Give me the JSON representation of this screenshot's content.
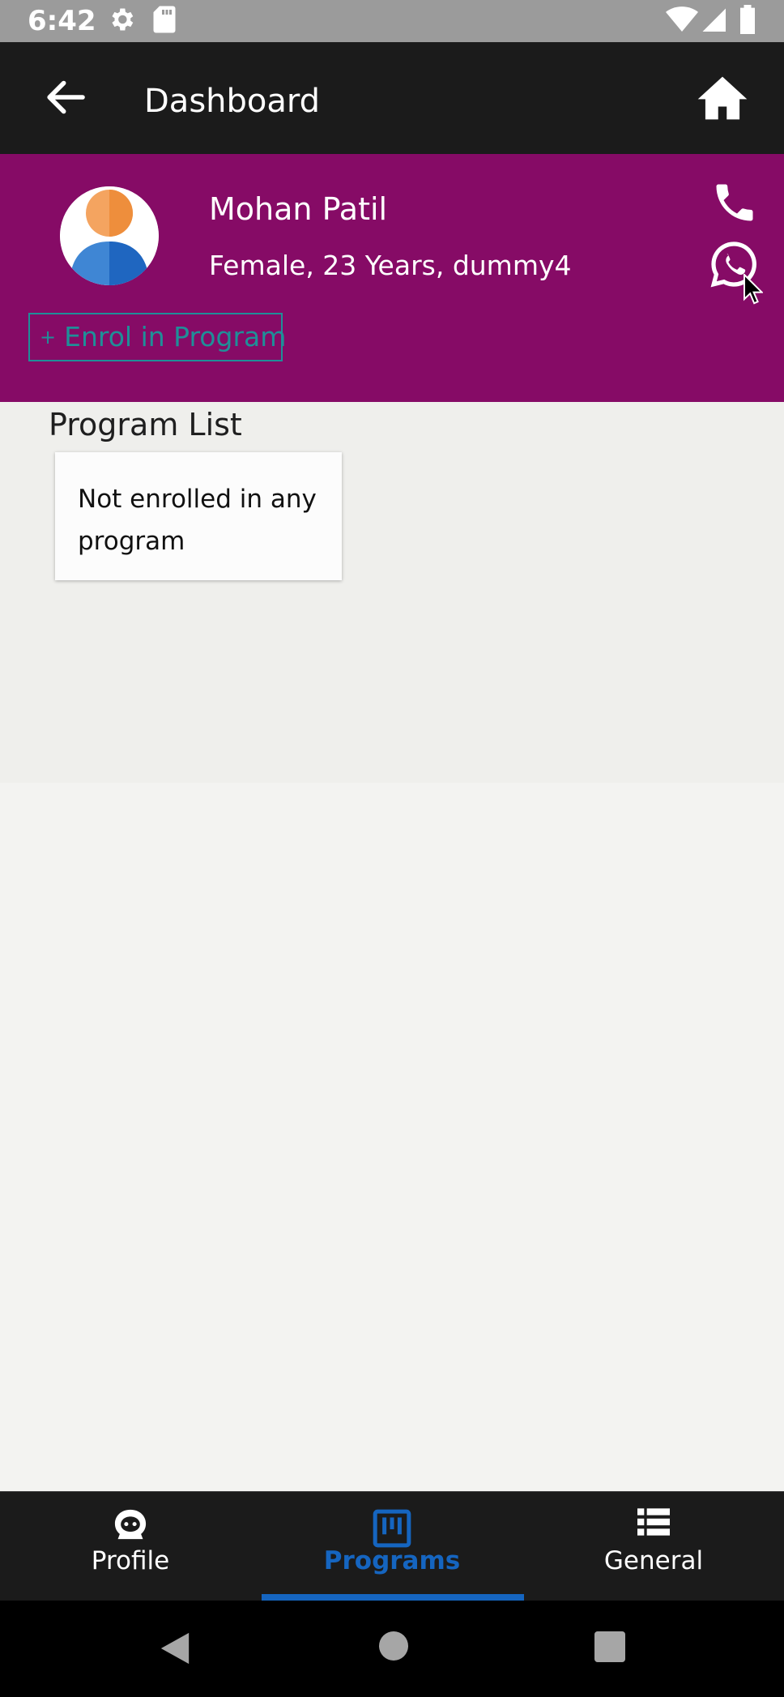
{
  "status_bar": {
    "time": "6:42",
    "icons": [
      "settings-icon",
      "sd-card-icon",
      "wifi-icon",
      "signal-icon",
      "battery-icon"
    ]
  },
  "app_bar": {
    "title": "Dashboard",
    "back_icon": "arrow-back-icon",
    "home_icon": "home-icon"
  },
  "profile": {
    "name": "Mohan Patil",
    "details": "Female, 23 Years, dummy4",
    "enrol_plus": "+",
    "enrol_label": "Enrol in Program",
    "call_icon": "phone-icon",
    "whatsapp_icon": "whatsapp-icon",
    "background_color": "#860b66",
    "accent_color": "#1f8f98"
  },
  "programs": {
    "section_title": "Program List",
    "empty_message": "Not enrolled in any program"
  },
  "bottom_nav": {
    "active_color": "#1565c0",
    "items": [
      {
        "label": "Profile",
        "icon": "profile-face-icon",
        "active": false
      },
      {
        "label": "Programs",
        "icon": "programs-board-icon",
        "active": true
      },
      {
        "label": "General",
        "icon": "list-icon",
        "active": false
      }
    ]
  },
  "system_nav": {
    "buttons": [
      "back-triangle-icon",
      "home-circle-icon",
      "recents-square-icon"
    ]
  }
}
